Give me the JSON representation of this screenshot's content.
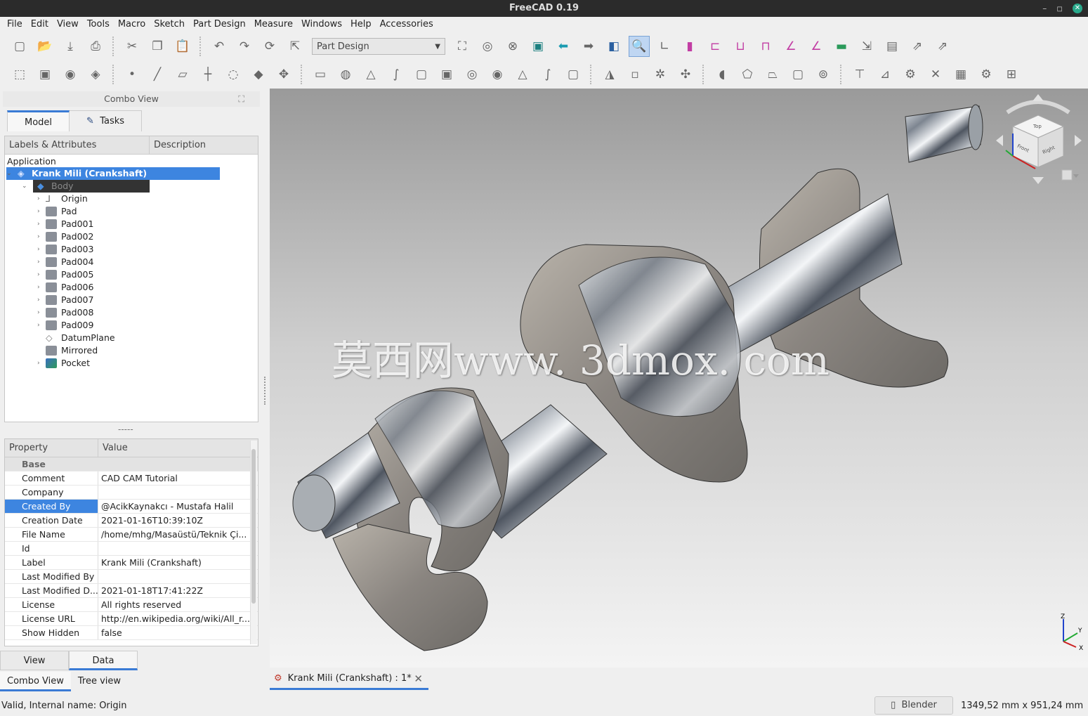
{
  "window": {
    "title": "FreeCAD 0.19"
  },
  "menu": [
    "File",
    "Edit",
    "View",
    "Tools",
    "Macro",
    "Sketch",
    "Part Design",
    "Measure",
    "Windows",
    "Help",
    "Accessories"
  ],
  "toolbar": {
    "workbench": "Part Design"
  },
  "combo": {
    "title": "Combo View",
    "tabs": [
      "Model",
      "Tasks"
    ],
    "tree_headers": [
      "Labels & Attributes",
      "Description"
    ],
    "app_label": "Application",
    "root": "Krank Mili (Crankshaft)",
    "body": "Body",
    "items": [
      "Origin",
      "Pad",
      "Pad001",
      "Pad002",
      "Pad003",
      "Pad004",
      "Pad005",
      "Pad006",
      "Pad007",
      "Pad008",
      "Pad009",
      "DatumPlane",
      "Mirrored",
      "Pocket"
    ]
  },
  "props": {
    "headers": [
      "Property",
      "Value"
    ],
    "group": "Base",
    "rows": [
      [
        "Comment",
        "CAD CAM Tutorial"
      ],
      [
        "Company",
        ""
      ],
      [
        "Created By",
        "@AcikKaynakcı - Mustafa Halil"
      ],
      [
        "Creation Date",
        "2021-01-16T10:39:10Z"
      ],
      [
        "File Name",
        "/home/mhg/Masaüstü/Teknik Çi..."
      ],
      [
        "Id",
        ""
      ],
      [
        "Label",
        "Krank Mili (Crankshaft)"
      ],
      [
        "Last Modified By",
        ""
      ],
      [
        "Last Modified D...",
        "2021-01-18T17:41:22Z"
      ],
      [
        "License",
        "All rights reserved"
      ],
      [
        "License URL",
        "http://en.wikipedia.org/wiki/All_r..."
      ],
      [
        "Show Hidden",
        "false"
      ]
    ],
    "view_tabs": [
      "View",
      "Data"
    ],
    "combo_tabs": [
      "Combo View",
      "Tree view"
    ]
  },
  "viewport": {
    "watermark": "莫西网www. 3dmox. com",
    "cube": {
      "top": "Top",
      "front": "Front",
      "right": "Right"
    },
    "axes": {
      "x": "X",
      "y": "Y",
      "z": "Z"
    }
  },
  "doc_tab": "Krank Mili (Crankshaft) : 1*",
  "status": {
    "message": "Valid, Internal name: Origin",
    "nav": "Blender",
    "dims": "1349,52 mm x 951,24 mm"
  }
}
